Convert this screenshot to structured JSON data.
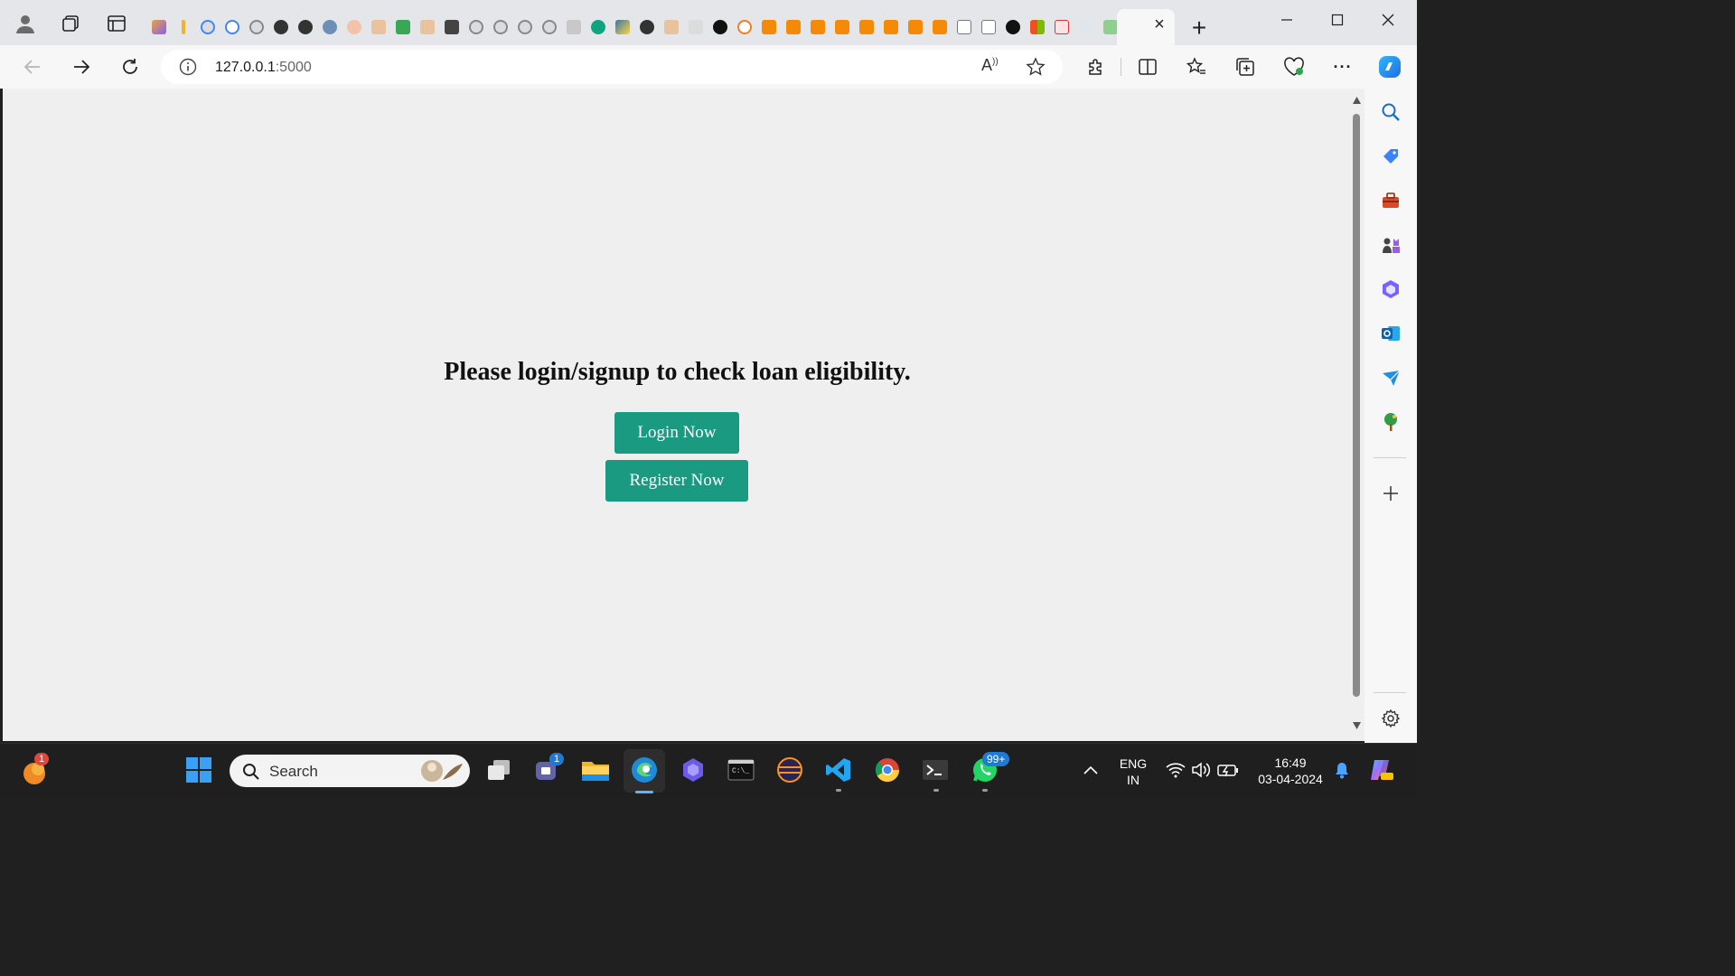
{
  "browser": {
    "active_tab_close_label": "×",
    "new_tab_label": "+",
    "address": {
      "host": "127.0.0.1",
      "port": ":5000"
    },
    "read_aloud_label": "A",
    "menu_label": "···"
  },
  "page": {
    "heading": "Please login/signup to check loan eligibility.",
    "login_button": "Login Now",
    "register_button": "Register Now",
    "accent_color": "#1a9a80"
  },
  "taskbar": {
    "search_placeholder": "Search",
    "notification_badge": "1",
    "teams_badge": "1",
    "whatsapp_badge": "99+",
    "language": {
      "line1": "ENG",
      "line2": "IN"
    },
    "clock": {
      "time": "16:49",
      "date": "03-04-2024"
    }
  },
  "colors": {
    "tabstrip": "#e4e6e9",
    "toolbar": "#f7f7f7",
    "content_bg": "#efefef",
    "taskbar": "#1f1f1f"
  }
}
